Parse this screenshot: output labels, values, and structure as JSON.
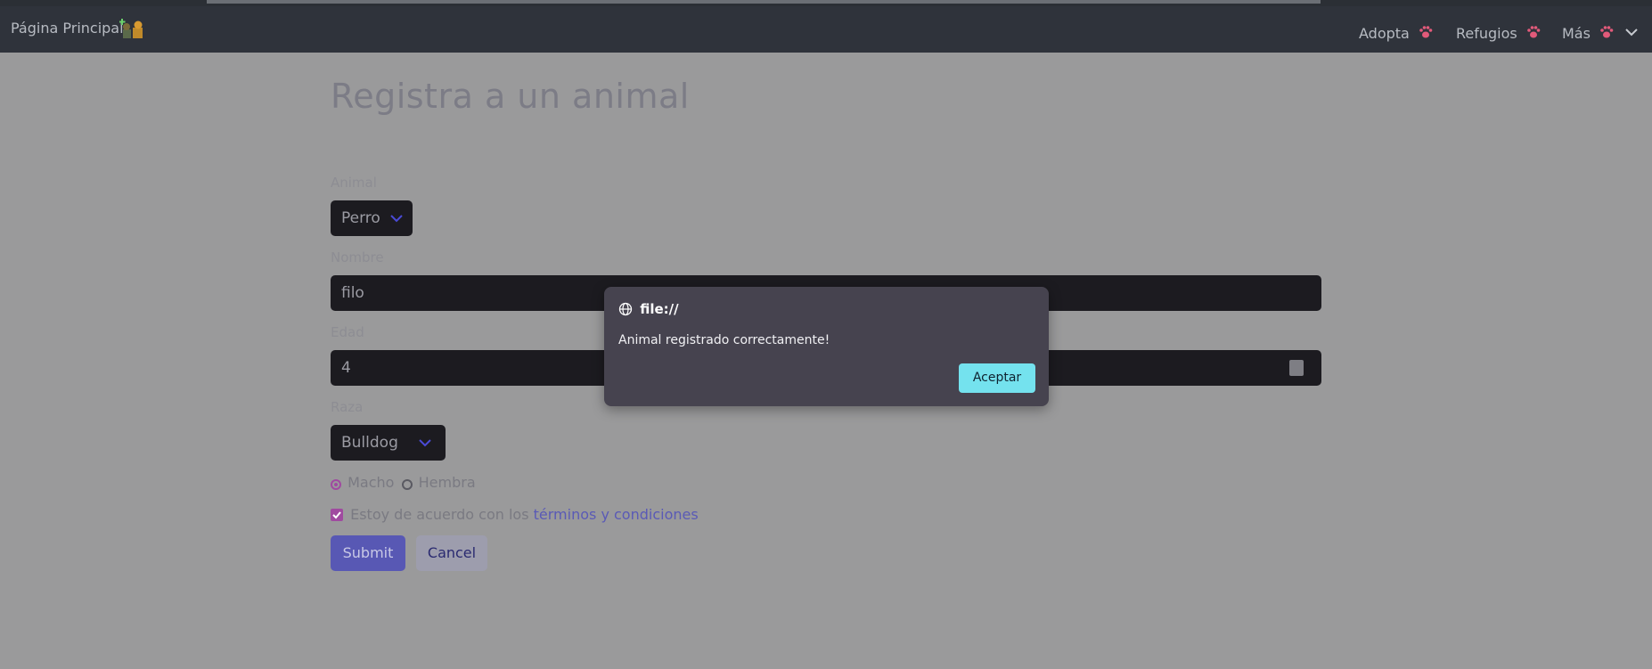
{
  "navbar": {
    "brand": "Página Principal",
    "links": [
      "Adopta",
      "Refugios",
      "Más"
    ]
  },
  "page": {
    "title": "Registra a un animal"
  },
  "form": {
    "animal_label": "Animal",
    "animal_value": "Perro",
    "nombre_label": "Nombre",
    "nombre_value": "filo",
    "edad_label": "Edad",
    "edad_value": "4",
    "raza_label": "Raza",
    "raza_value": "Bulldog",
    "sexo_options": [
      "Macho",
      "Hembra"
    ],
    "sexo_selected": "Macho",
    "terms_text": "Estoy de acuerdo con los",
    "terms_link": "términos y condiciones",
    "terms_checked": true,
    "submit_label": "Submit",
    "cancel_label": "Cancel"
  },
  "dialog": {
    "origin": "file://",
    "message": "Animal registrado correctamente!",
    "ok_label": "Aceptar"
  },
  "colors": {
    "accent_cyan": "#74e2ee",
    "submit_purple": "#5858b4",
    "checkbox_magenta": "#a04aa0",
    "navbar": "#2f333b"
  },
  "icons": [
    "pets-brand-icon",
    "paw-icon",
    "chevron-down-icon",
    "globe-icon",
    "check-icon"
  ]
}
